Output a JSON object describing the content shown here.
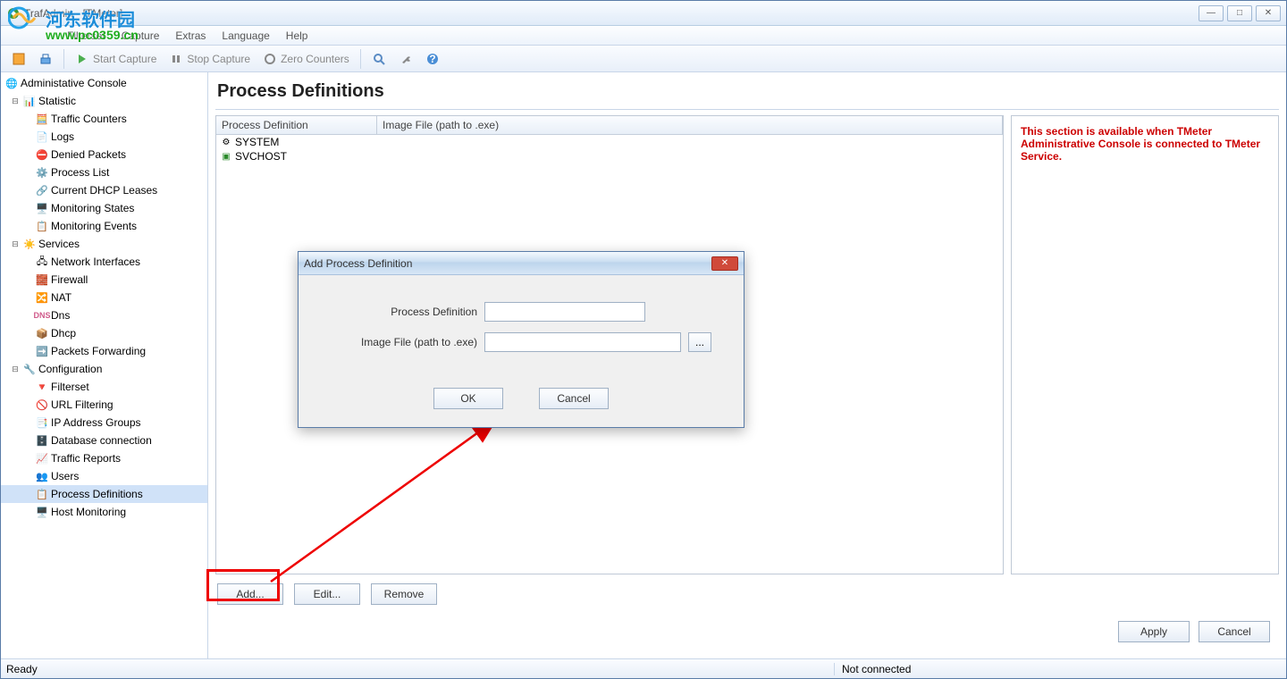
{
  "window": {
    "title": "TrafAdmin - [TMeter]"
  },
  "win_controls": {
    "min": "—",
    "max": "□",
    "close": "✕"
  },
  "menu": {
    "filterset": "Filterset",
    "capture": "Capture",
    "extras": "Extras",
    "language": "Language",
    "help": "Help"
  },
  "toolbar": {
    "start": "Start Capture",
    "stop": "Stop Capture",
    "zero": "Zero Counters"
  },
  "tree": {
    "root": "Administative Console",
    "statistic": {
      "label": "Statistic",
      "items": {
        "counters": "Traffic Counters",
        "logs": "Logs",
        "denied": "Denied Packets",
        "process": "Process List",
        "dhcp": "Current DHCP Leases",
        "monstates": "Monitoring States",
        "monevents": "Monitoring Events"
      }
    },
    "services": {
      "label": "Services",
      "items": {
        "net": "Network Interfaces",
        "fw": "Firewall",
        "nat": "NAT",
        "dns": "Dns",
        "dhcp": "Dhcp",
        "fwd": "Packets Forwarding"
      }
    },
    "config": {
      "label": "Configuration",
      "items": {
        "filterset": "Filterset",
        "urlfilt": "URL Filtering",
        "ipgroups": "IP Address Groups",
        "db": "Database connection",
        "reports": "Traffic Reports",
        "users": "Users",
        "procdef": "Process Definitions",
        "hostmon": "Host Monitoring"
      }
    }
  },
  "page": {
    "title": "Process Definitions"
  },
  "list": {
    "cols": {
      "pd": "Process Definition",
      "img": "Image File (path to .exe)"
    },
    "rows": [
      {
        "name": "SYSTEM"
      },
      {
        "name": "SVCHOST"
      }
    ]
  },
  "notice": "This section is available when TMeter Administrative Console is connected to TMeter Service.",
  "btns": {
    "add": "Add...",
    "edit": "Edit...",
    "remove": "Remove",
    "apply": "Apply",
    "cancel": "Cancel"
  },
  "dialog": {
    "title": "Add Process Definition",
    "pd_label": "Process Definition",
    "img_label": "Image File (path to .exe)",
    "pd_value": "",
    "img_value": "",
    "browse": "...",
    "ok": "OK",
    "cancel": "Cancel",
    "close": "✕"
  },
  "status": {
    "left": "Ready",
    "right": "Not connected"
  },
  "watermark": {
    "cn": "河东软件园",
    "url": "www.pc0359.cn"
  }
}
